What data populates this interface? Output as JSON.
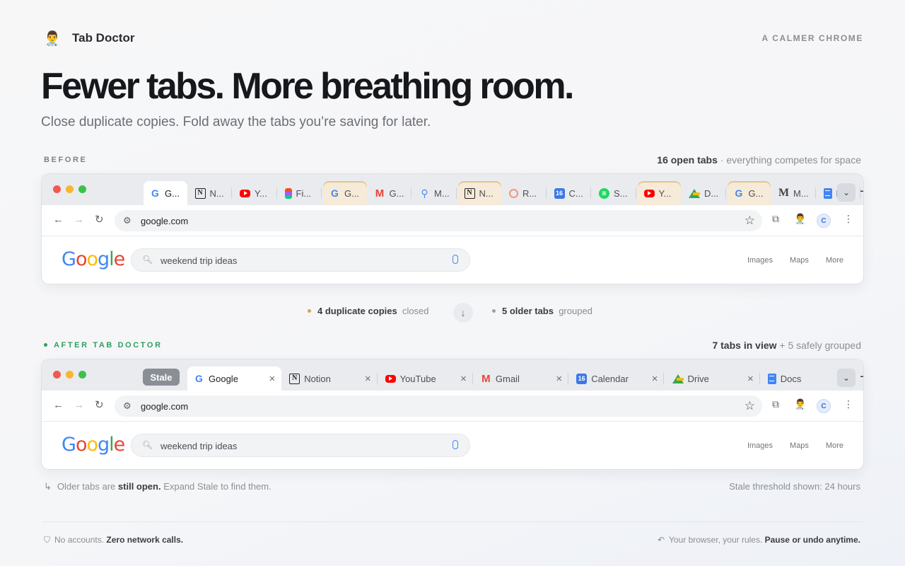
{
  "brand": {
    "name": "Tab Doctor",
    "logo_icon": "doctor-emoji",
    "logo_glyph": "👨‍⚕️"
  },
  "tagline": "A CALMER CHROME",
  "headline": "Fewer tabs. More breathing room.",
  "subline": "Close duplicate copies. Fold away the tabs you’re saving for later.",
  "before": {
    "label": "BEFORE",
    "count_bold": "16 open tabs",
    "count_rest": " · everything competes for space",
    "tabs": [
      {
        "label": "G...",
        "icon": "google-icon",
        "state": "active"
      },
      {
        "label": "N...",
        "icon": "notion-icon",
        "state": "normal"
      },
      {
        "label": "Y...",
        "icon": "youtube-icon",
        "state": "normal"
      },
      {
        "label": "Fi...",
        "icon": "figma-icon",
        "state": "normal"
      },
      {
        "label": "G...",
        "icon": "google-icon",
        "state": "duplicate"
      },
      {
        "label": "G...",
        "icon": "gmail-icon",
        "state": "normal"
      },
      {
        "label": "M...",
        "icon": "maps-pin-icon",
        "state": "normal"
      },
      {
        "label": "N...",
        "icon": "notion-icon",
        "state": "duplicate"
      },
      {
        "label": "R...",
        "icon": "ring-icon",
        "state": "normal"
      },
      {
        "label": "C...",
        "icon": "calendar-icon",
        "state": "normal"
      },
      {
        "label": "S...",
        "icon": "spotify-icon",
        "state": "normal"
      },
      {
        "label": "Y...",
        "icon": "youtube-icon",
        "state": "duplicate"
      },
      {
        "label": "D...",
        "icon": "drive-icon",
        "state": "normal"
      },
      {
        "label": "G...",
        "icon": "google-icon",
        "state": "duplicate"
      },
      {
        "label": "M...",
        "icon": "medium-icon",
        "state": "normal"
      },
      {
        "label": "D...",
        "icon": "docs-icon",
        "state": "normal"
      }
    ]
  },
  "summary": {
    "dup_bold": "4 duplicate copies",
    "dup_rest": "closed",
    "dup_color": "#d4a05a",
    "older_bold": "5 older tabs",
    "older_rest": "grouped",
    "older_color": "#9aa0a6"
  },
  "after": {
    "label": "AFTER TAB DOCTOR",
    "label_color": "#2f9e62",
    "count_bold": "7 tabs in view",
    "count_rest": " + 5 safely grouped",
    "stale_label": "Stale",
    "tabs": [
      {
        "label": "Google",
        "icon": "google-icon",
        "state": "active"
      },
      {
        "label": "Notion",
        "icon": "notion-icon",
        "state": "normal"
      },
      {
        "label": "YouTube",
        "icon": "youtube-icon",
        "state": "normal"
      },
      {
        "label": "Gmail",
        "icon": "gmail-icon",
        "state": "normal"
      },
      {
        "label": "Calendar",
        "icon": "calendar-icon",
        "state": "normal"
      },
      {
        "label": "Drive",
        "icon": "drive-icon",
        "state": "normal"
      },
      {
        "label": "Docs",
        "icon": "docs-icon",
        "state": "normal"
      }
    ]
  },
  "browser": {
    "url": "google.com",
    "search_query": "weekend trip ideas",
    "links": [
      "Images",
      "Maps",
      "More"
    ],
    "avatar_letter": "C",
    "logo_text": "Google",
    "calendar_num": "16"
  },
  "notes": {
    "left_pre": "Older tabs are ",
    "left_bold": "still open.",
    "left_post": " Expand Stale to find them.",
    "right": "Stale threshold shown: 24 hours"
  },
  "footer": {
    "left_pre": "No accounts. ",
    "left_bold": "Zero network calls.",
    "right_pre": "Your browser, your rules. ",
    "right_bold": "Pause or undo anytime."
  }
}
